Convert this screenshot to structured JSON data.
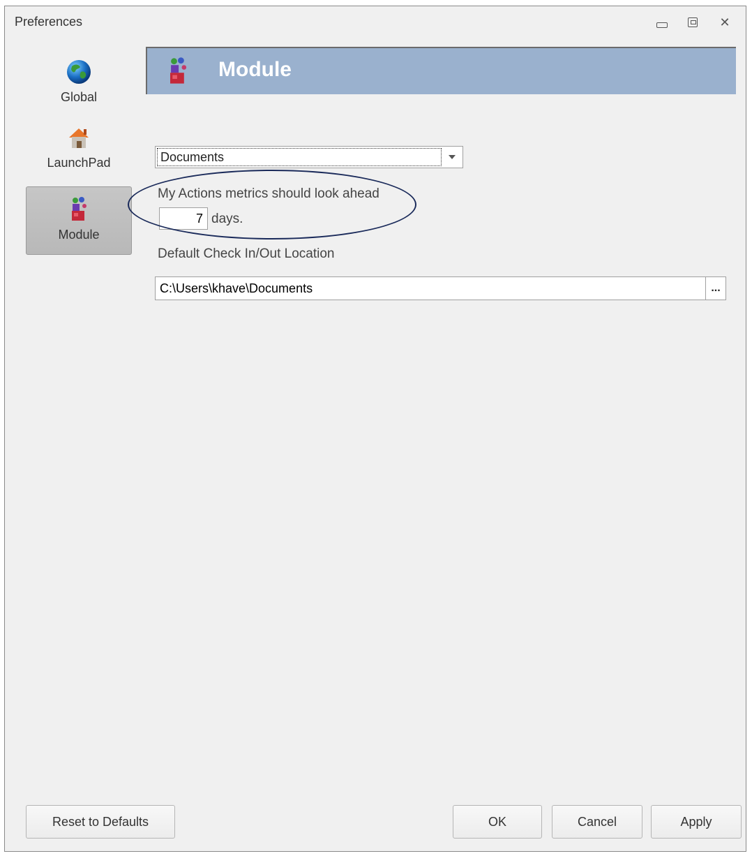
{
  "window": {
    "title": "Preferences"
  },
  "nav": {
    "items": [
      {
        "label": "Global",
        "icon": "globe-icon"
      },
      {
        "label": "LaunchPad",
        "icon": "house-icon"
      },
      {
        "label": "Module",
        "icon": "module-icon",
        "selected": true
      }
    ]
  },
  "header": {
    "title": "Module",
    "background": "#9ab1ce"
  },
  "module": {
    "selected_type": "Documents",
    "metrics_label": "My Actions metrics should look ahead",
    "lookahead_days": "7",
    "days_suffix": "days.",
    "checkin_label": "Default Check In/Out Location",
    "checkin_path": "C:\\Users\\khave\\Documents",
    "browse_label": "..."
  },
  "footer": {
    "reset_label": "Reset to Defaults",
    "ok_label": "OK",
    "cancel_label": "Cancel",
    "apply_label": "Apply"
  }
}
